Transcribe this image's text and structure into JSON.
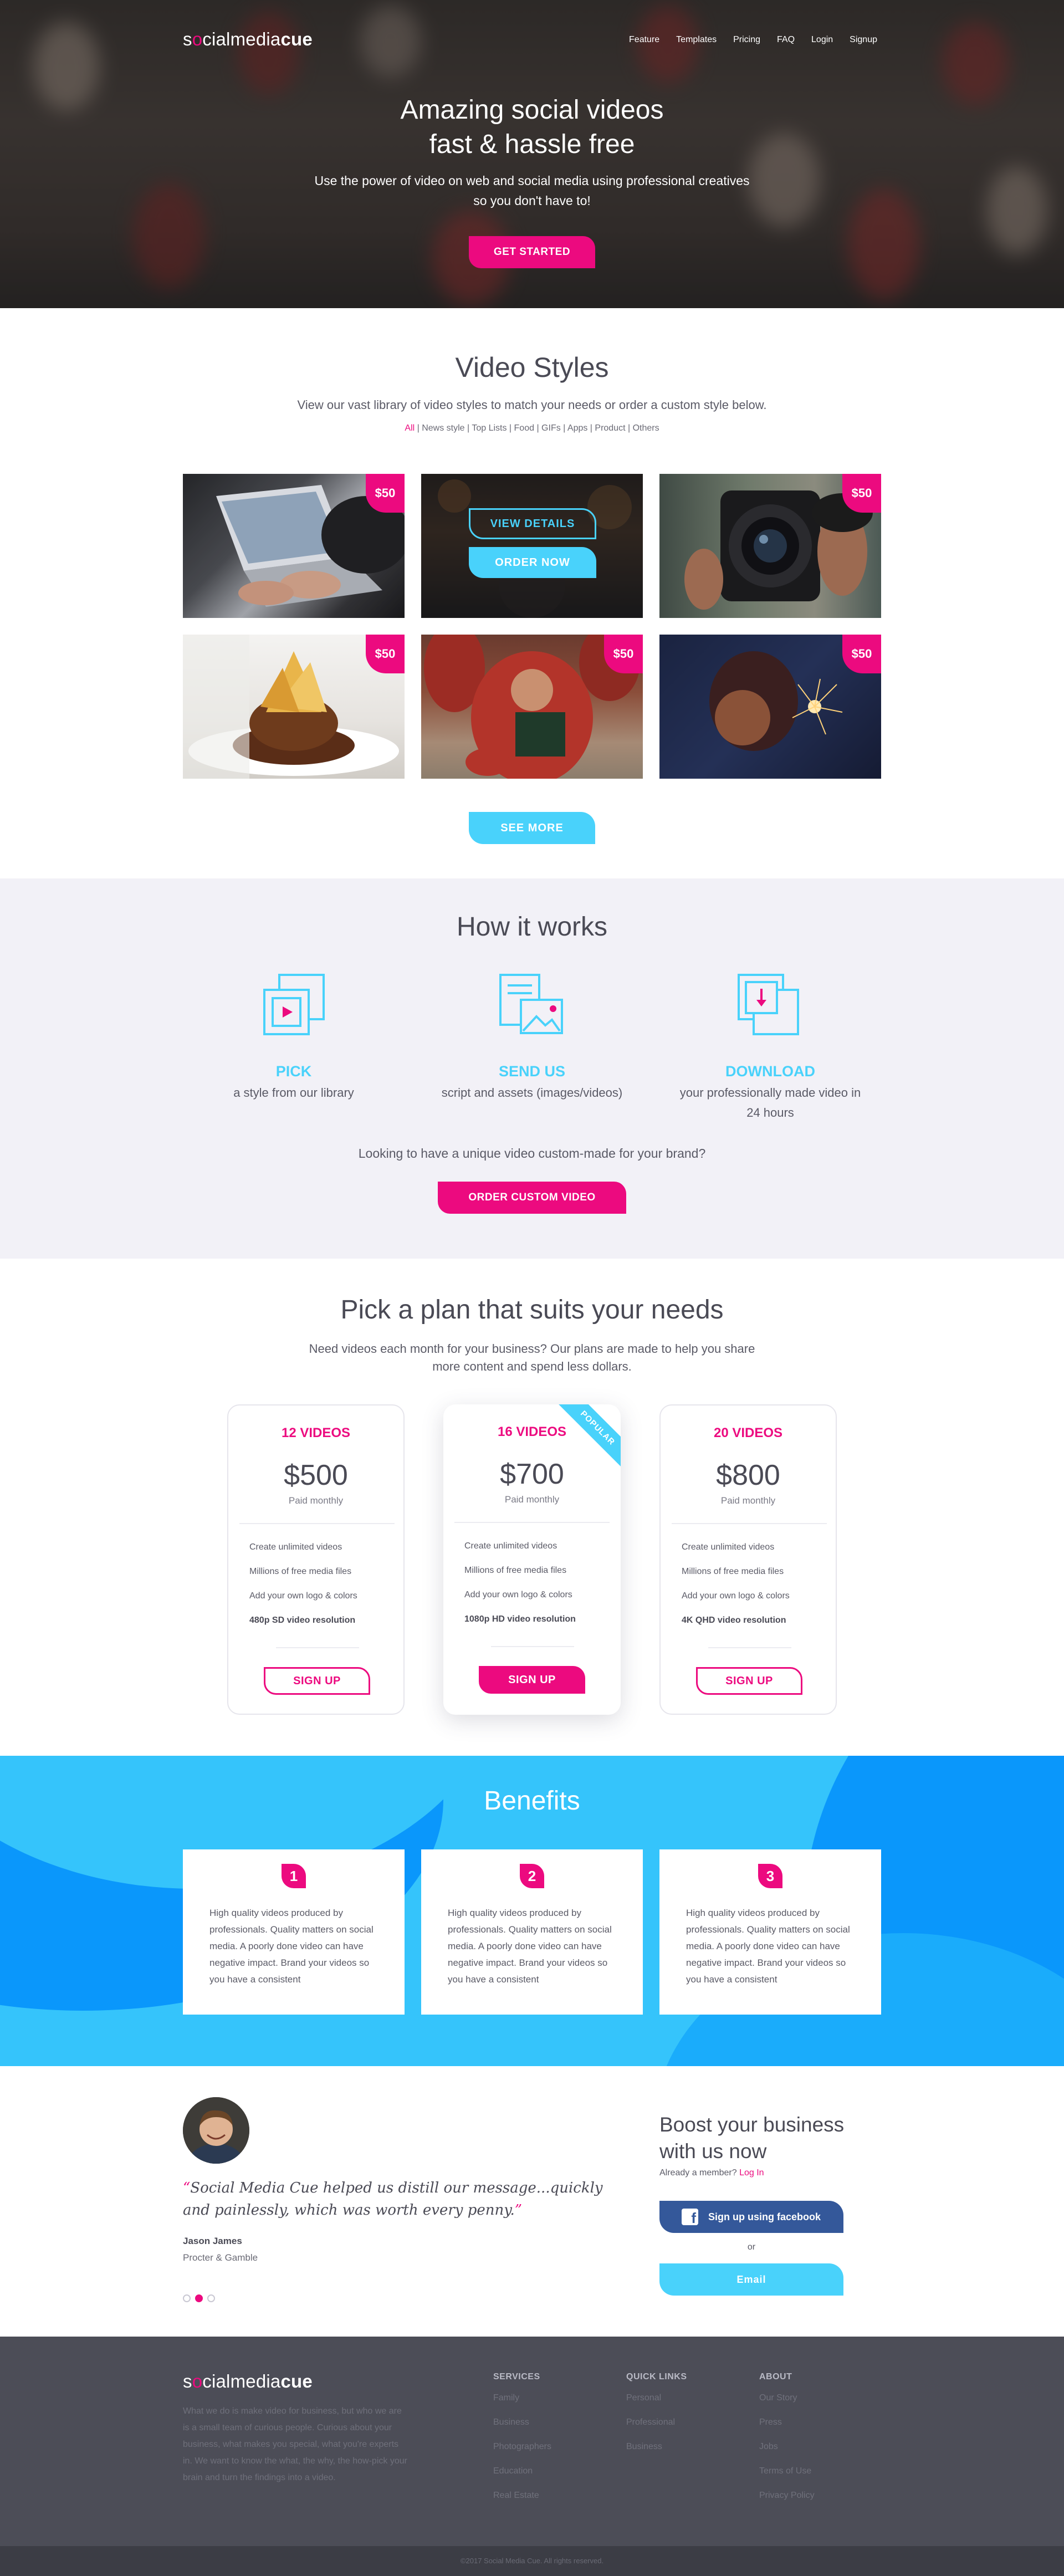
{
  "header": {
    "brand": {
      "first": "s",
      "dot": "o",
      "mid": "cialmedia",
      "bold": "cue"
    },
    "nav": [
      "Feature",
      "Templates",
      "Pricing",
      "FAQ",
      "Login",
      "Signup"
    ]
  },
  "hero": {
    "title_line1": "Amazing social videos",
    "title_line2": "fast & hassle free",
    "subtitle_line1": "Use the power of video on web and social media using professional creatives",
    "subtitle_line2": "so you don't have to!",
    "cta": "GET STARTED"
  },
  "video_styles": {
    "title": "Video Styles",
    "subtitle": "View our vast library of video styles to match your needs or order a custom style below.",
    "filters": [
      "All",
      "News style",
      "Top Lists",
      "Food",
      "GIFs",
      "Apps",
      "Product",
      "Others"
    ],
    "filter_sep": " | ",
    "tiles": [
      {
        "price": "$50",
        "icon": "laptop-photo"
      },
      {
        "details": "VIEW DETAILS",
        "order": "ORDER NOW",
        "icon": "dark-scene-photo"
      },
      {
        "price": "$50",
        "icon": "camera-photo"
      },
      {
        "price": "$50",
        "icon": "food-photo"
      },
      {
        "price": "$50",
        "icon": "reading-monk-photo"
      },
      {
        "price": "$50",
        "icon": "sparkler-photo"
      }
    ],
    "see_more": "SEE MORE"
  },
  "how_it_works": {
    "title": "How it works",
    "steps": [
      {
        "title": "PICK",
        "text": "a style from our library",
        "icon": "video-stack-icon"
      },
      {
        "title": "SEND US",
        "text": "script and assets (images/videos)",
        "icon": "image-doc-icon"
      },
      {
        "title": "DOWNLOAD",
        "text_line1": "your professionally made video in",
        "text_line2": "24 hours",
        "icon": "download-icon"
      }
    ],
    "question": "Looking to have a unique video custom-made for your brand?",
    "cta": "ORDER CUSTOM VIDEO"
  },
  "pricing": {
    "title": "Pick a plan that suits your needs",
    "subtitle_line1": "Need videos each month for your business? Our plans are made to help you share",
    "subtitle_line2": "more content and spend less dollars.",
    "plans": [
      {
        "name": "12 VIDEOS",
        "price": "$500",
        "period": "Paid monthly",
        "features": [
          "Create unlimited videos",
          "Millions of free media files",
          "Add your own logo & colors",
          "480p SD video resolution"
        ],
        "button": "SIGN UP"
      },
      {
        "name": "16 VIDEOS",
        "price": "$700",
        "period": "Paid monthly",
        "features": [
          "Create unlimited videos",
          "Millions of free media files",
          "Add your own logo & colors",
          "1080p HD video resolution"
        ],
        "button": "SIGN UP",
        "ribbon": "POPULAR"
      },
      {
        "name": "20 VIDEOS",
        "price": "$800",
        "period": "Paid monthly",
        "features": [
          "Create unlimited videos",
          "Millions of free media files",
          "Add your own logo & colors",
          "4K QHD video resolution"
        ],
        "button": "SIGN UP"
      }
    ]
  },
  "benefits": {
    "title": "Benefits",
    "items": [
      {
        "num": "1",
        "text": "High quality videos produced by professionals. Quality matters on social media. A poorly done video can have negative impact. Brand your videos so you have a consistent"
      },
      {
        "num": "2",
        "text": "High quality videos produced by professionals. Quality matters on social media. A poorly done video can have negative impact. Brand your videos so you have a consistent"
      },
      {
        "num": "3",
        "text": "High quality videos produced by professionals. Quality matters on social media. A poorly done video can have negative impact. Brand your videos so you have a consistent"
      }
    ]
  },
  "testimonial": {
    "quote_open": "“",
    "quote": "Social Media Cue helped us distill our message...quickly and painlessly, which was worth every penny.",
    "quote_close": "”",
    "author": "Jason James",
    "company": "Procter & Gamble"
  },
  "signup": {
    "title_line1": "Boost your business",
    "title_line2": "with us now",
    "member_text": "Already a member?",
    "login": "Log In",
    "facebook": "Sign up using facebook",
    "or": "or",
    "email": "Email"
  },
  "footer": {
    "about": "What we do is make video for business, but who we are is a small team of curious people. Curious about your business, what makes you special, what you're experts in. We want to know the what, the why, the how-pick your brain and turn the findings into a video.",
    "columns": [
      {
        "title": "SERVICES",
        "links": [
          "Family",
          "Business",
          "Photographers",
          "Education",
          "Real Estate"
        ]
      },
      {
        "title": "QUICK LINKS",
        "links": [
          "Personal",
          "Professional",
          "Business"
        ]
      },
      {
        "title": "ABOUT",
        "links": [
          "Our Story",
          "Press",
          "Jobs",
          "Terms of Use",
          "Privacy Policy"
        ]
      }
    ],
    "copyright": "©2017 Social Media Cue. All rights reserved."
  },
  "colors": {
    "pink": "#ec0a7f",
    "blue": "#49d2fb",
    "dark": "#4c4d57",
    "facebook": "#34589a"
  }
}
